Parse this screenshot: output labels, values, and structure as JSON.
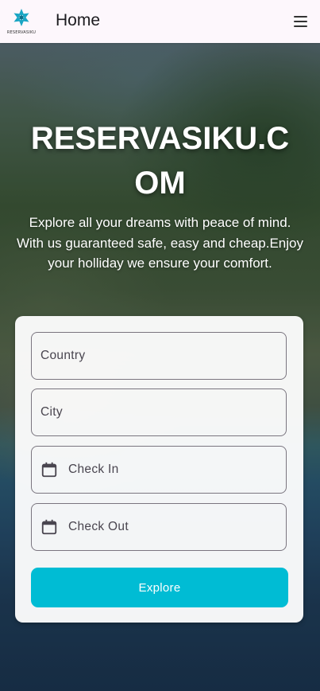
{
  "appbar": {
    "logo_text": "RESERVASIKU",
    "title": "Home",
    "menu_icon": "hamburger-menu-icon"
  },
  "hero": {
    "title": "RESERVASIKU.COM",
    "subtitle": "Explore all your dreams with peace of mind. With us guaranteed safe, easy and cheap.Enjoy your holliday we ensure your comfort."
  },
  "search_form": {
    "country_label": "Country",
    "city_label": "City",
    "check_in_label": "Check In",
    "check_out_label": "Check Out",
    "calendar_icon": "calendar-icon",
    "explore_label": "Explore"
  },
  "colors": {
    "accent": "#00bcd4",
    "appbar_bg": "#fdf7fc",
    "logo": "#1aa6c4"
  }
}
